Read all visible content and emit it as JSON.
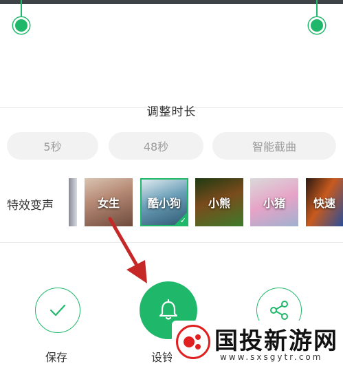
{
  "trim": {
    "title": "调整时长"
  },
  "duration_options": [
    {
      "label": "5秒"
    },
    {
      "label": "48秒"
    },
    {
      "label": "智能截曲"
    }
  ],
  "effects": {
    "label": "特效变声",
    "items": [
      {
        "label": "女生",
        "selected": false
      },
      {
        "label": "酷小狗",
        "selected": true
      },
      {
        "label": "小熊",
        "selected": false
      },
      {
        "label": "小猪",
        "selected": false
      },
      {
        "label": "快速",
        "selected": false
      }
    ]
  },
  "actions": {
    "save": {
      "label": "保存",
      "icon": "check-icon"
    },
    "ringtone": {
      "label": "设铃",
      "icon": "bell-icon"
    },
    "share": {
      "icon": "share-icon"
    }
  },
  "watermark": {
    "title": "国投新游网",
    "url": "www.sxsgytr.com"
  },
  "colors": {
    "accent": "#1fb86a",
    "annotation_arrow": "#c62828"
  }
}
